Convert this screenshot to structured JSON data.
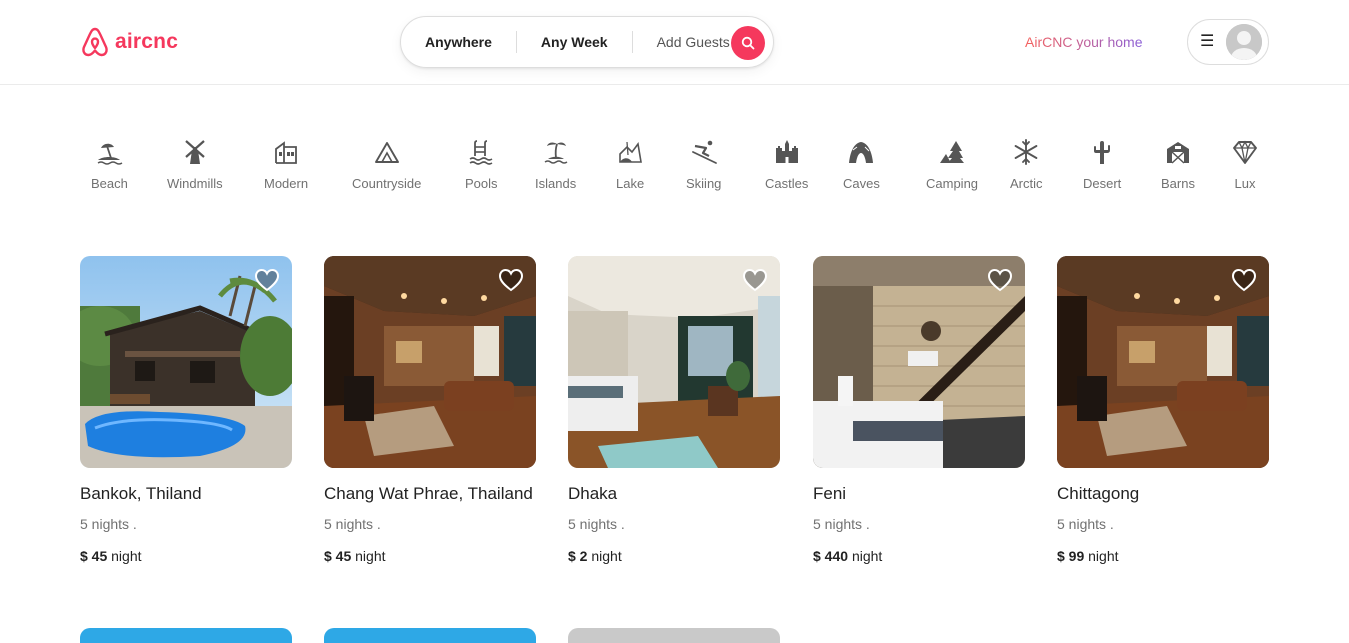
{
  "brand": {
    "name": "aircnc",
    "color": "#f5385d"
  },
  "search": {
    "location": "Anywhere",
    "week": "Any Week",
    "guests": "Add Guests",
    "button_icon": "search-icon"
  },
  "header": {
    "host_link": "AirCNC your home",
    "menu_icon": "hamburger-icon",
    "avatar_icon": "user-avatar-icon"
  },
  "categories": [
    {
      "label": "Beach",
      "icon": "beach-icon"
    },
    {
      "label": "Windmills",
      "icon": "windmill-icon"
    },
    {
      "label": "Modern",
      "icon": "modern-building-icon"
    },
    {
      "label": "Countryside",
      "icon": "mountain-icon"
    },
    {
      "label": "Pools",
      "icon": "pool-icon"
    },
    {
      "label": "Islands",
      "icon": "island-icon"
    },
    {
      "label": "Lake",
      "icon": "lake-icon"
    },
    {
      "label": "Skiing",
      "icon": "skiing-icon"
    },
    {
      "label": "Castles",
      "icon": "castle-icon"
    },
    {
      "label": "Caves",
      "icon": "cave-icon"
    },
    {
      "label": "Camping",
      "icon": "camping-icon"
    },
    {
      "label": "Arctic",
      "icon": "snowflake-icon"
    },
    {
      "label": "Desert",
      "icon": "cactus-icon"
    },
    {
      "label": "Barns",
      "icon": "barn-icon"
    },
    {
      "label": "Lux",
      "icon": "diamond-icon"
    }
  ],
  "listings": [
    {
      "title": "Bankok, Thiland",
      "nights": "5 nights .",
      "price": "$ 45",
      "unit": "night"
    },
    {
      "title": "Chang Wat Phrae, Thailand",
      "nights": "5 nights .",
      "price": "$ 45",
      "unit": "night"
    },
    {
      "title": "Dhaka",
      "nights": "5 nights .",
      "price": "$ 2",
      "unit": "night"
    },
    {
      "title": "Feni",
      "nights": "5 nights .",
      "price": "$ 440",
      "unit": "night"
    },
    {
      "title": "Chittagong",
      "nights": "5 nights .",
      "price": "$ 99",
      "unit": "night"
    }
  ]
}
